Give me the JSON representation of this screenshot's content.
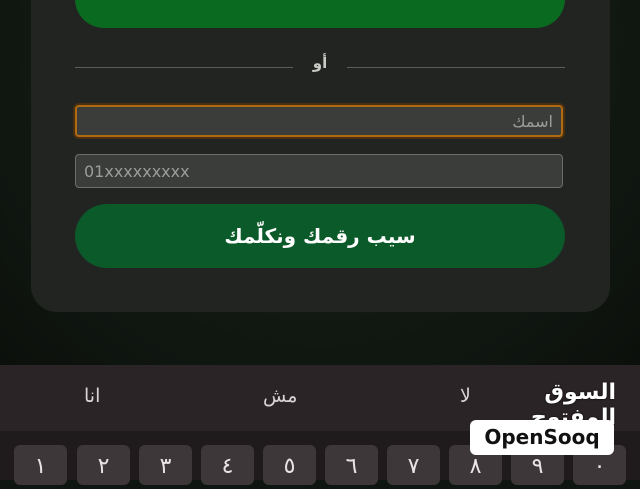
{
  "top_button": {
    "glyph": "…"
  },
  "divider": {
    "text": "أو"
  },
  "form": {
    "name_placeholder": "اسمك",
    "phone_placeholder": "01xxxxxxxxx",
    "save_label": "سيب رقمك ونكلّمك"
  },
  "keyboard": {
    "suggestions": [
      "انا",
      "مش",
      "لا"
    ],
    "keys": [
      "١",
      "٢",
      "٣",
      "٤",
      "٥",
      "٦",
      "٧",
      "٨",
      "٩",
      "٠"
    ]
  },
  "watermark": {
    "arabic": "السوق المفتوح",
    "latin": "OpenSooq"
  },
  "colors": {
    "accent_green": "#0b5a2a",
    "focus_orange": "#b06a12"
  }
}
